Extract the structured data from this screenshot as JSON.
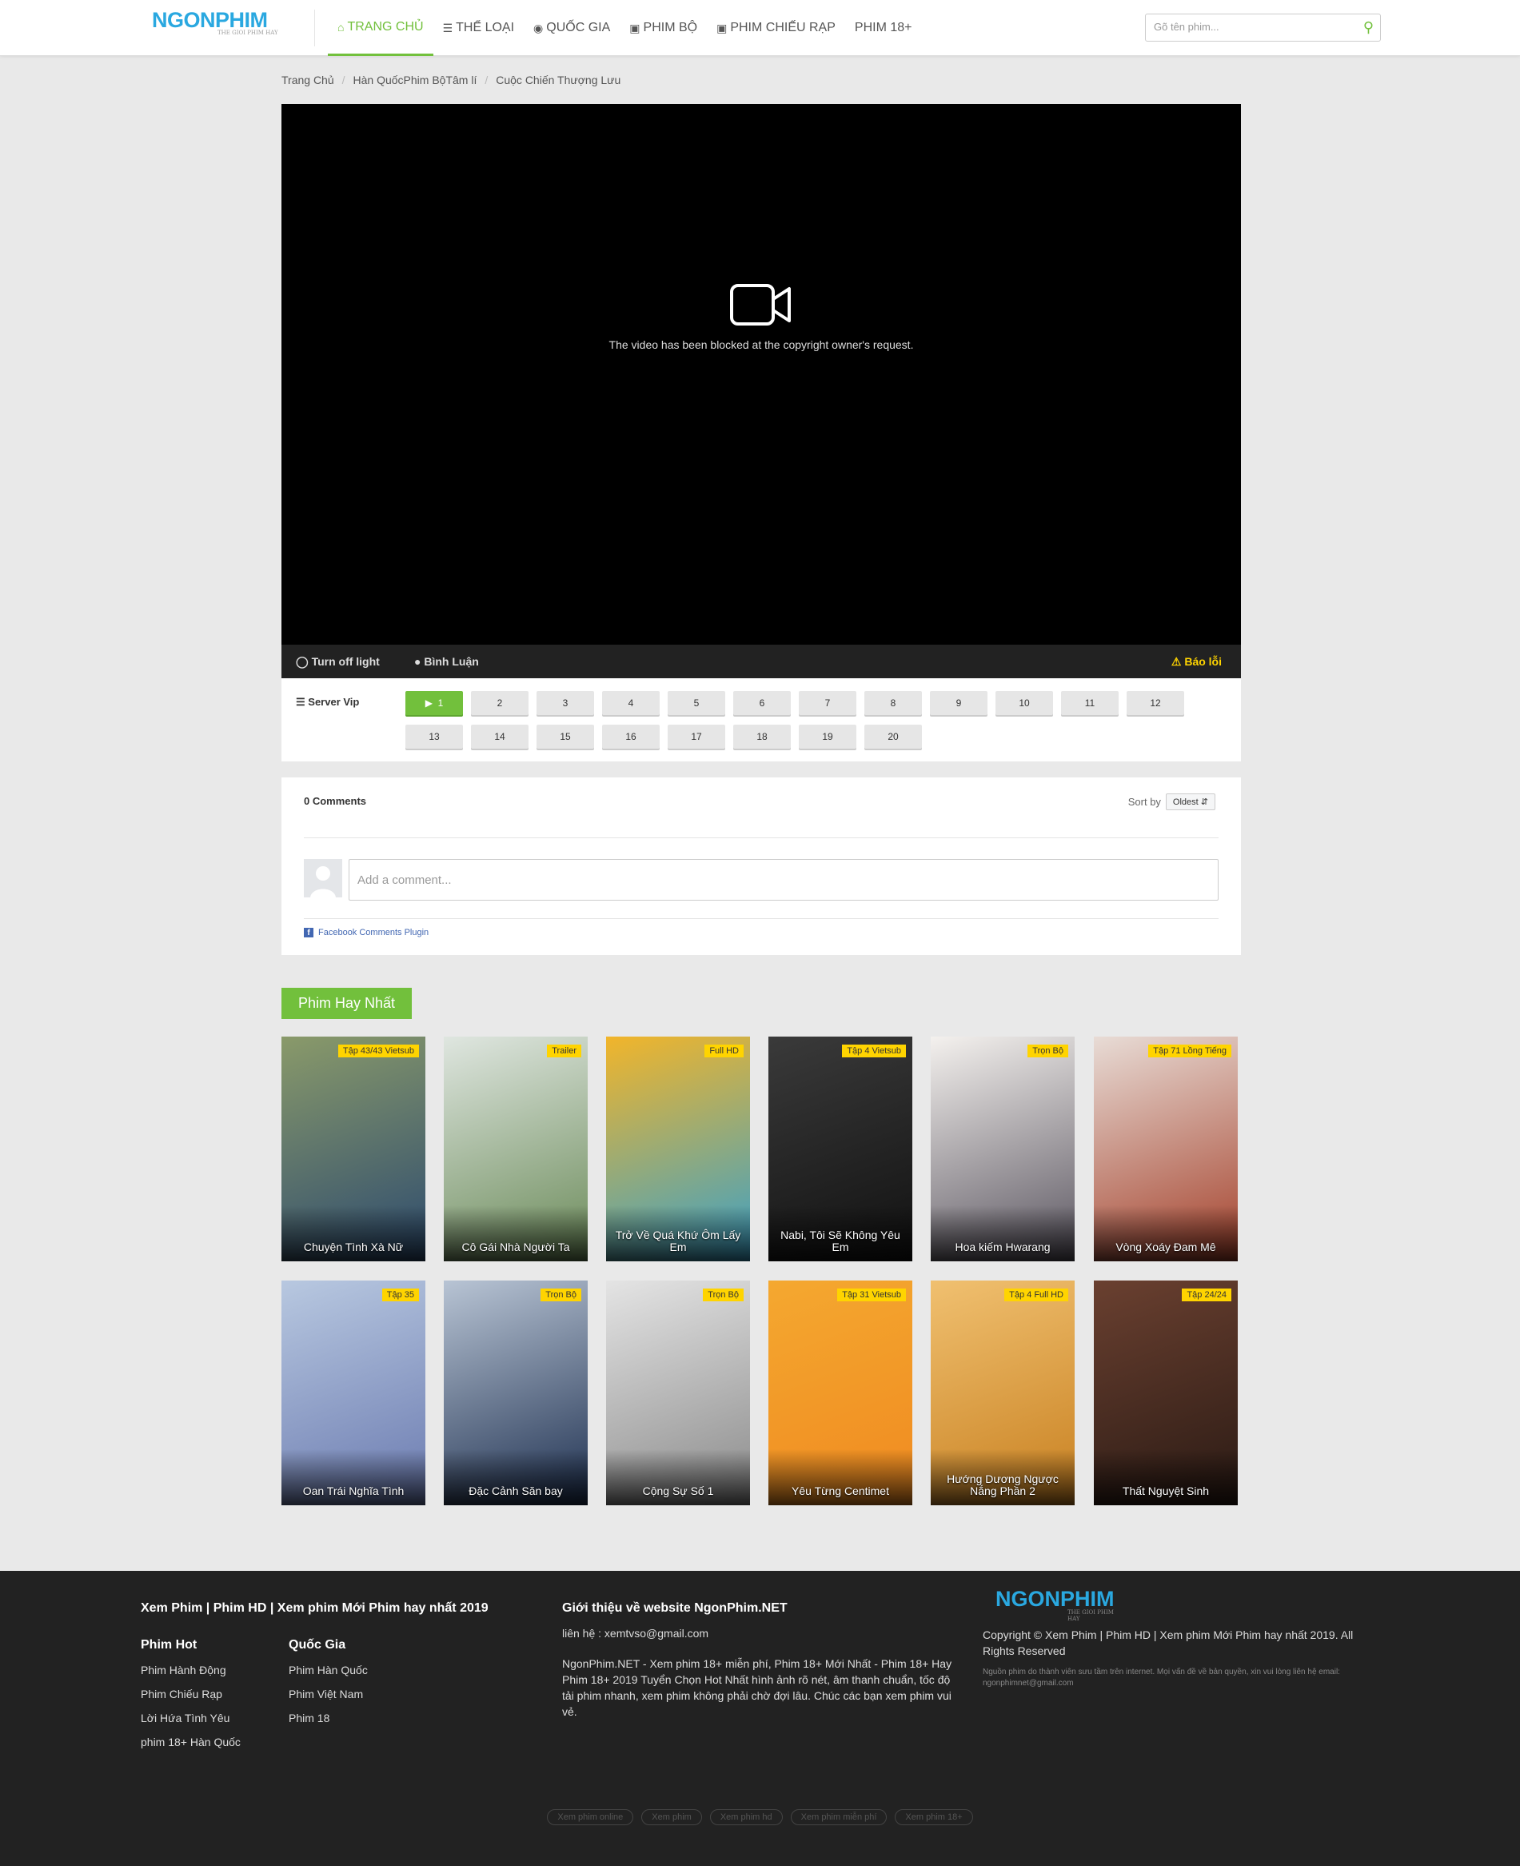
{
  "header": {
    "logo_main": "NGONPHIM",
    "logo_tag": "THE GIOI PHIM HAY",
    "nav": [
      {
        "label": "TRANG CHỦ",
        "icon": "home-icon"
      },
      {
        "label": "THỂ LOẠI",
        "icon": "list-icon"
      },
      {
        "label": "QUỐC GIA",
        "icon": "globe-icon"
      },
      {
        "label": "PHIM BỘ",
        "icon": "film-icon"
      },
      {
        "label": "PHIM CHIẾU RẠP",
        "icon": "film-icon"
      },
      {
        "label": "PHIM 18+",
        "icon": ""
      }
    ],
    "search_placeholder": "Gõ tên phim...",
    "accent": "#72c03c"
  },
  "breadcrumb": [
    "Trang Chủ",
    "Hàn QuốcPhim BộTâm lí",
    "Cuộc Chiến Thượng Lưu"
  ],
  "player": {
    "message": "The video has been blocked at the copyright owner's request.",
    "turn_off_light": "Turn off light",
    "comment_label": "Bình Luận",
    "report_label": "Báo lỗi"
  },
  "servers": {
    "label": "Server Vip",
    "episodes": [
      "1",
      "2",
      "3",
      "4",
      "5",
      "6",
      "7",
      "8",
      "9",
      "10",
      "11",
      "12",
      "13",
      "14",
      "15",
      "16",
      "17",
      "18",
      "19",
      "20"
    ],
    "active": "1"
  },
  "comments": {
    "count_label": "0 Comments",
    "sort_label": "Sort by",
    "sort_value": "Oldest",
    "placeholder": "Add a comment...",
    "plugin_label": "Facebook Comments Plugin"
  },
  "section": {
    "title": "Phim Hay Nhất",
    "movies": [
      {
        "title": "Chuyện Tình Xà Nữ",
        "badge": "Tập 43/43 Vietsub",
        "colors": [
          "#8a9a6a",
          "#2c4a6e"
        ]
      },
      {
        "title": "Cô Gái Nhà Người Ta",
        "badge": "Trailer",
        "colors": [
          "#dfe6e0",
          "#6a8a58"
        ]
      },
      {
        "title": "Trở Về Quá Khứ Ôm Lấy Em",
        "badge": "Full HD",
        "colors": [
          "#f2b52a",
          "#3aa0c8"
        ]
      },
      {
        "title": "Nabi, Tôi Sẽ Không Yêu Em",
        "badge": "Tập 4 Vietsub",
        "colors": [
          "#3a3a3a",
          "#111111"
        ]
      },
      {
        "title": "Hoa kiếm Hwarang",
        "badge": "Trọn Bộ",
        "colors": [
          "#f4f1ee",
          "#5a5560"
        ]
      },
      {
        "title": "Vòng Xoáy Đam Mê",
        "badge": "Tập 71 Lồng Tiếng",
        "colors": [
          "#e8dcd6",
          "#a4402a"
        ]
      },
      {
        "title": "Oan Trái Nghĩa Tình",
        "badge": "Tập 35",
        "colors": [
          "#b8c8e0",
          "#6a7ab0"
        ]
      },
      {
        "title": "Đặc Cảnh Săn bay",
        "badge": "Trọn Bộ",
        "colors": [
          "#b8c4d4",
          "#1e3050"
        ]
      },
      {
        "title": "Cộng Sự Số 1",
        "badge": "Trọn Bộ",
        "colors": [
          "#e4e4e4",
          "#8a8a8a"
        ]
      },
      {
        "title": "Yêu Từng Centimet",
        "badge": "Tập 31 Vietsub",
        "colors": [
          "#f4a830",
          "#f08a20"
        ]
      },
      {
        "title": "Hướng Dương Ngược Nắng Phần 2",
        "badge": "Tập 4 Full HD",
        "colors": [
          "#f0c070",
          "#c88020"
        ]
      },
      {
        "title": "Thất Nguyệt Sinh",
        "badge": "Tập 24/24",
        "colors": [
          "#6a4030",
          "#2a1a14"
        ]
      }
    ]
  },
  "footer": {
    "site_title": "Xem Phim | Phim HD | Xem phim Mới Phim hay nhất 2019",
    "hot_head": "Phim Hot",
    "hot_links": [
      "Phim Hành Động",
      "Phim Chiếu Rạp",
      "Lời Hứa Tình Yêu",
      "phim 18+ Hàn Quốc"
    ],
    "country_head": "Quốc Gia",
    "country_links": [
      "Phim Hàn Quốc",
      "Phim Việt Nam",
      "Phim 18"
    ],
    "about_head": "Giới thiệu về website NgonPhim.NET",
    "contact": "liên hệ : xemtvso@gmail.com",
    "about_text": "NgonPhim.NET - Xem phim 18+ miễn phí, Phim 18+ Mới Nhất - Phim 18+ Hay Phim 18+ 2019 Tuyển Chọn Hot Nhất hình ảnh rõ nét, âm thanh chuẩn, tốc độ tải phim nhanh, xem phim không phải chờ đợi lâu. Chúc các bạn xem phim vui vẻ.",
    "copyright": "Copyright © Xem Phim | Phim HD | Xem phim Mới Phim hay nhất 2019. All Rights Reserved",
    "disclaimer": "Nguồn phim do thành viên sưu tầm trên internet. Mọi vấn đề về bản quyền, xin vui lòng liên hệ email: ngonphimnet@gmail.com",
    "tags": [
      "Xem phim online",
      "Xem phim",
      "Xem phim hd",
      "Xem phim miễn phí",
      "Xem phim 18+"
    ]
  }
}
